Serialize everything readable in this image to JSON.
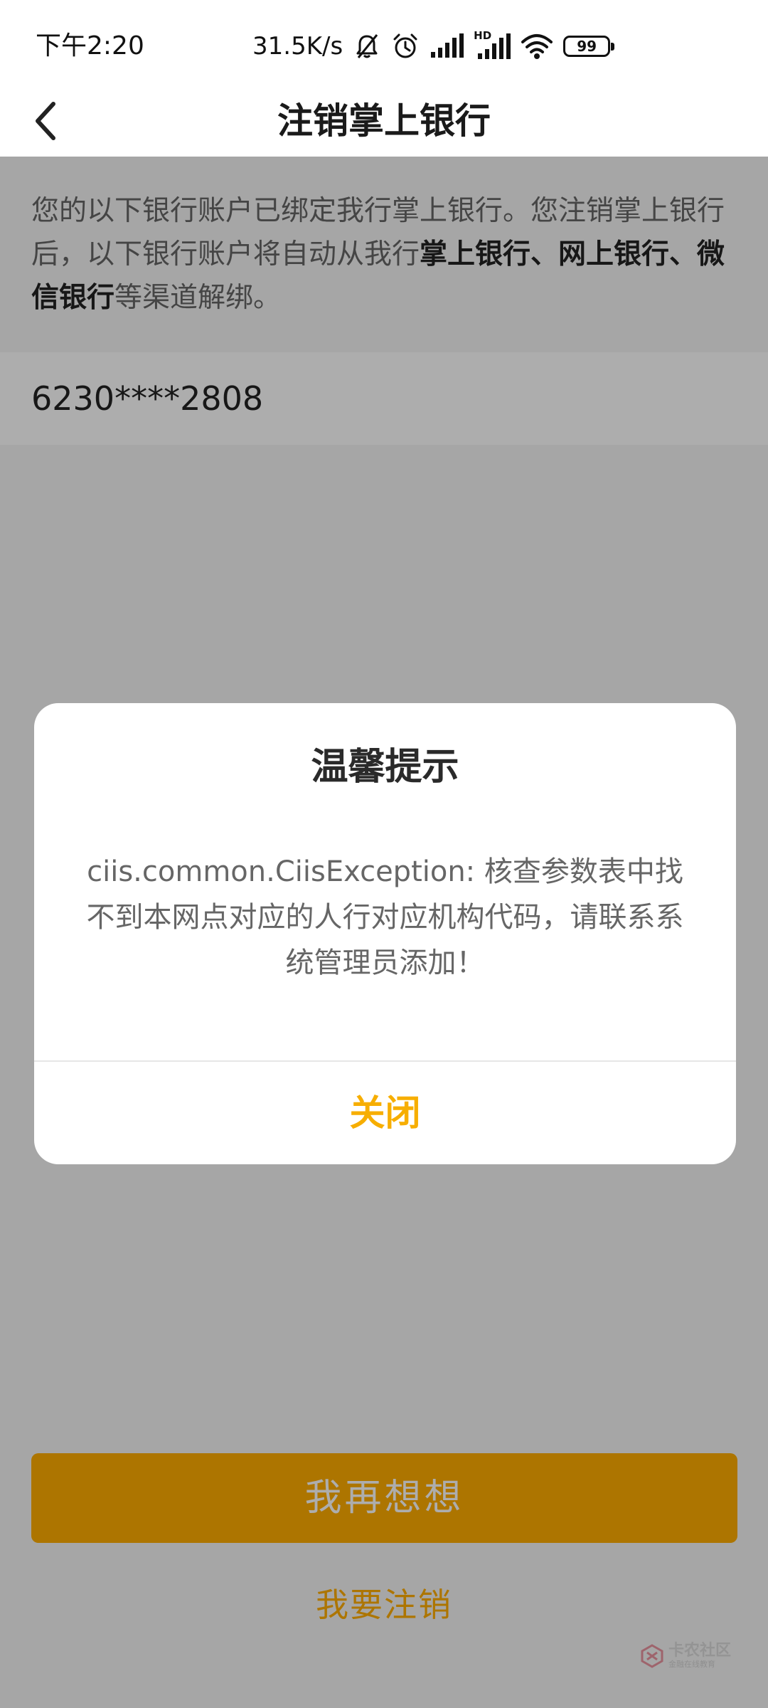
{
  "status_bar": {
    "time": "下午2:20",
    "net_speed": "31.5K/s",
    "network_label": "HD",
    "battery": "99",
    "icons": [
      "mute-bell-icon",
      "alarm-icon",
      "signal-icon",
      "hd-signal-icon",
      "wifi-icon",
      "battery-icon"
    ]
  },
  "nav": {
    "back_icon": "chevron-left-icon",
    "title": "注销掌上银行"
  },
  "notice": {
    "text_1": "您的以下银行账户已绑定我行掌上银行。您注销掌上银行后，以下银行账户将自动从我行",
    "bold": "掌上银行、网上银行、微信银行",
    "text_2": "等渠道解绑。"
  },
  "account": {
    "number": "6230****2808"
  },
  "actions": {
    "primary_label": "我再想想",
    "secondary_label": "我要注销"
  },
  "dialog": {
    "title": "温馨提示",
    "message": "ciis.common.CiisException: 核查参数表中找不到本网点对应的人行对应机构代码，请联系系统管理员添加！",
    "close_label": "关闭"
  },
  "watermark": {
    "name": "卡农社区",
    "subtitle": "金融在线教育"
  },
  "colors": {
    "accent": "#ffad00",
    "dialog_button": "#f7ae00",
    "overlay": "rgba(0,0,0,0.32)"
  }
}
